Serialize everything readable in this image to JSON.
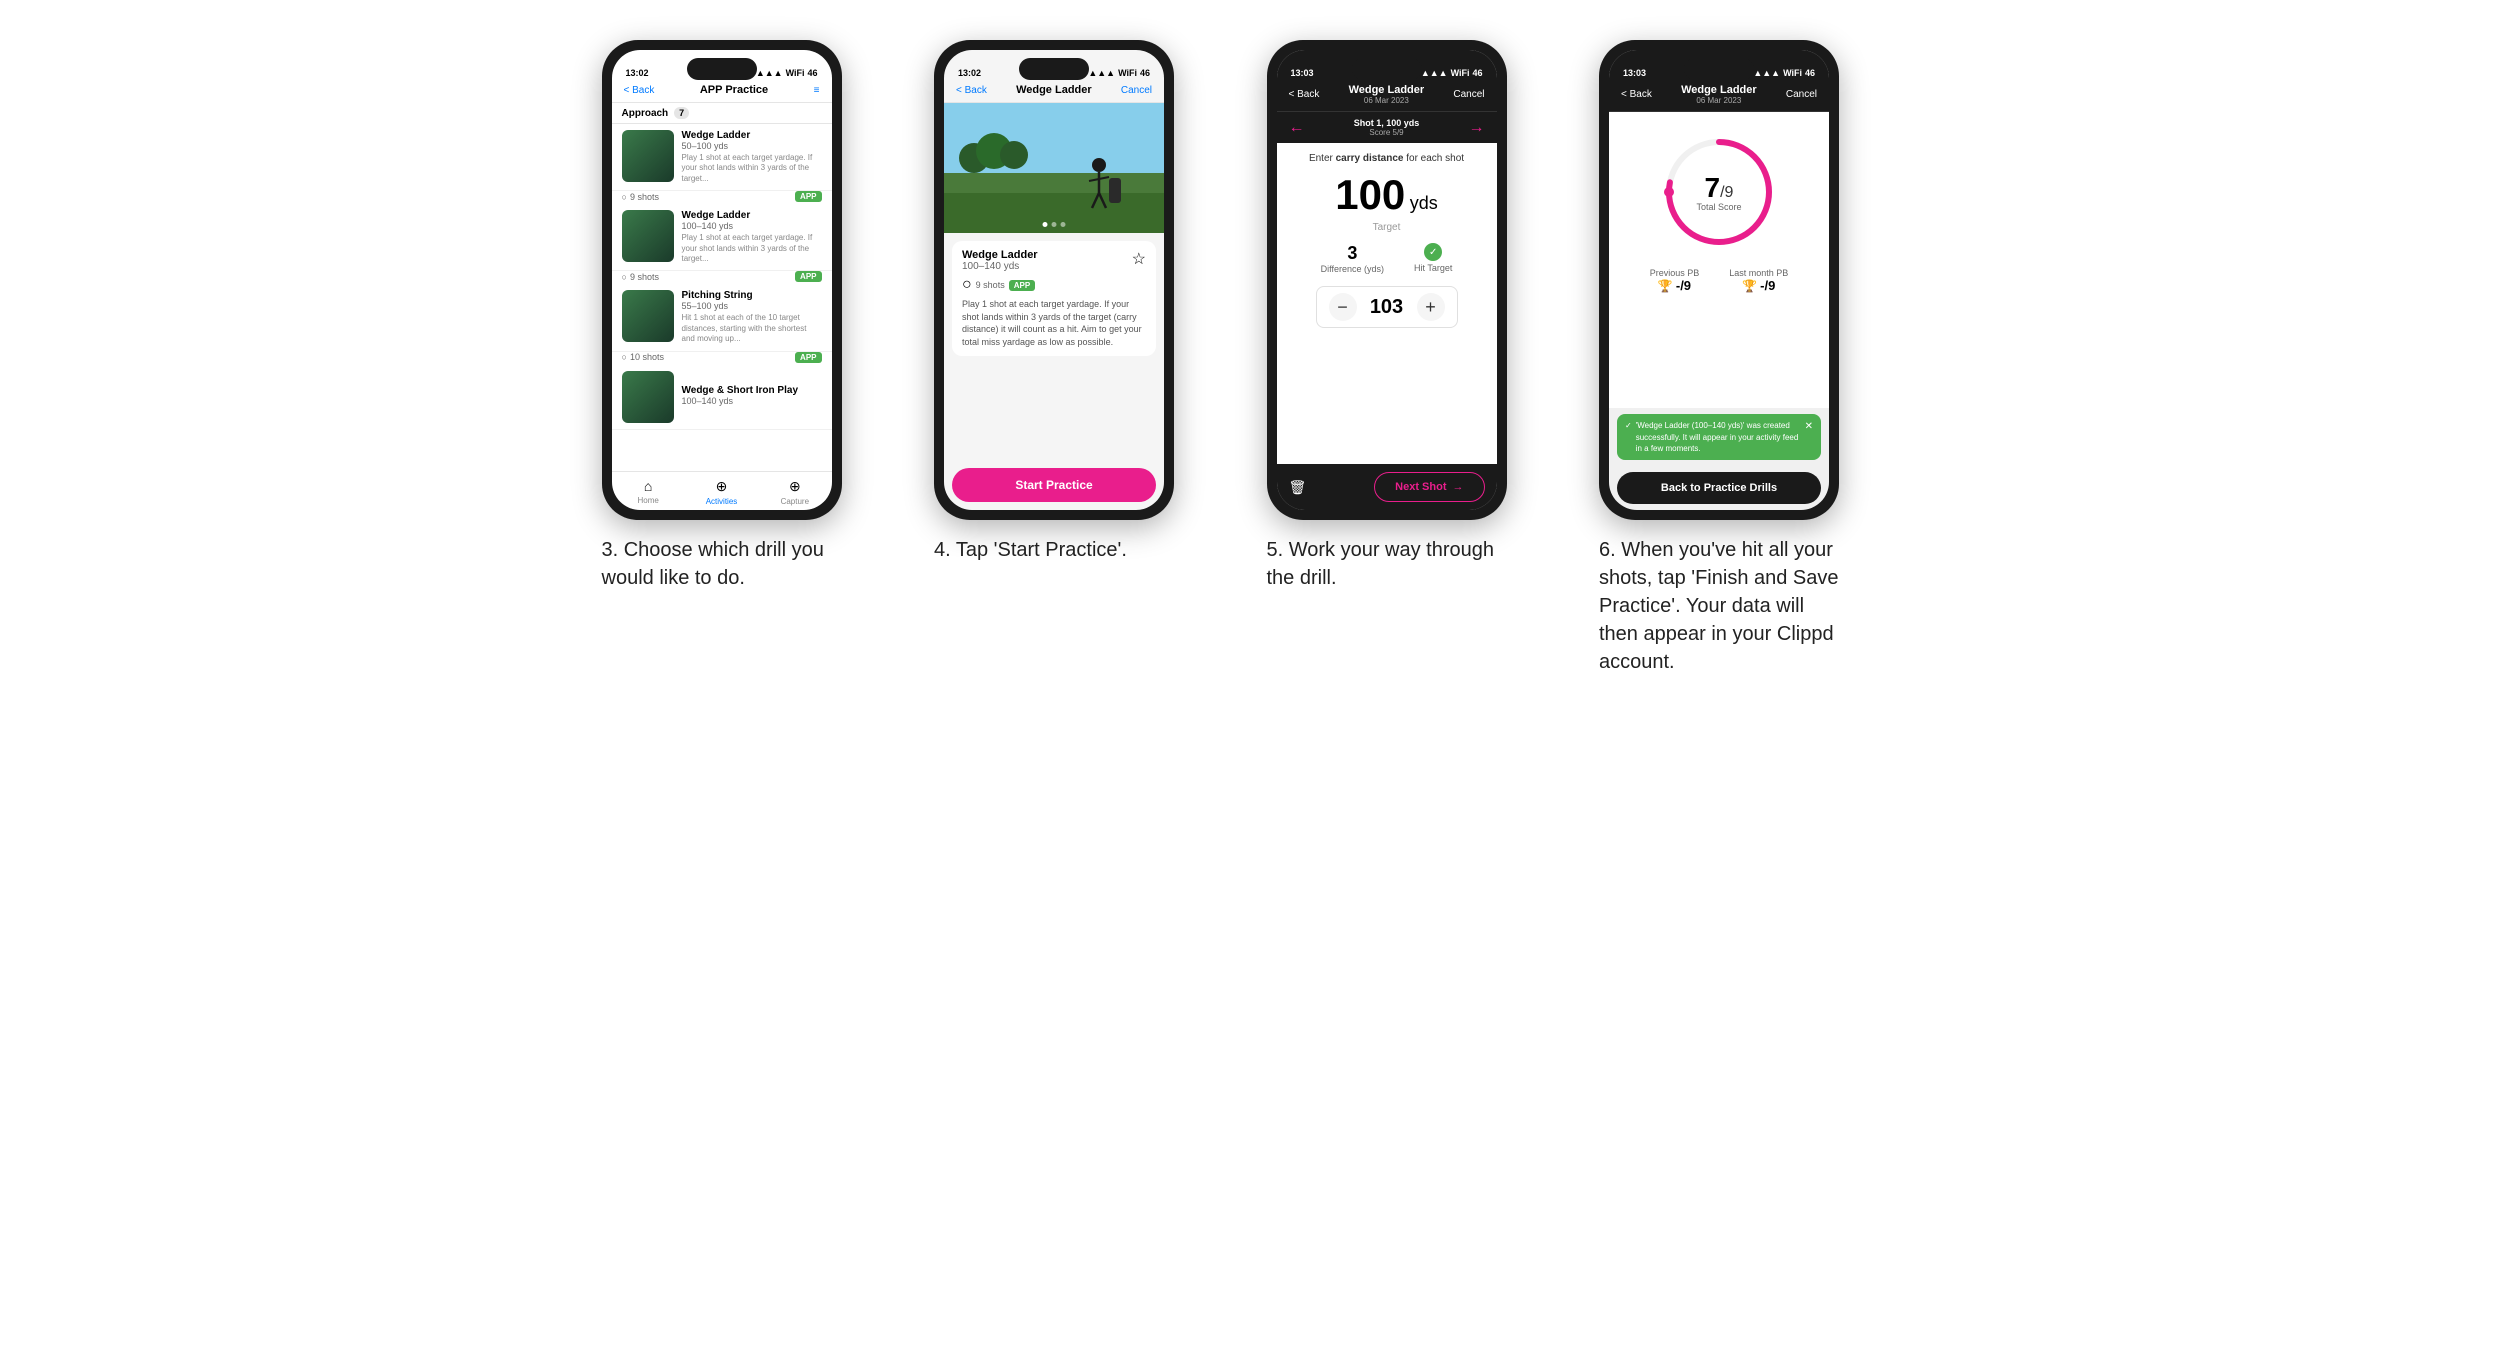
{
  "phones": [
    {
      "id": "phone1",
      "statusBar": {
        "time": "13:02",
        "signal": "▲▲▲",
        "wifi": "WiFi",
        "battery": "46"
      },
      "nav": {
        "back": "< Back",
        "title": "APP Practice",
        "action": "≡"
      },
      "section": {
        "label": "Approach",
        "count": "7"
      },
      "drills": [
        {
          "name": "Wedge Ladder",
          "yds": "50–100 yds",
          "desc": "Play 1 shot at each target yardage. If your shot lands within 3 yards of the target...",
          "shots": "9 shots",
          "badge": "APP"
        },
        {
          "name": "Wedge Ladder",
          "yds": "100–140 yds",
          "desc": "Play 1 shot at each target yardage. If your shot lands within 3 yards of the target...",
          "shots": "9 shots",
          "badge": "APP"
        },
        {
          "name": "Pitching String",
          "yds": "55–100 yds",
          "desc": "Hit 1 shot at each of the 10 target distances, starting with the shortest and moving up...",
          "shots": "10 shots",
          "badge": "APP"
        },
        {
          "name": "Wedge & Short Iron Play",
          "yds": "100–140 yds",
          "desc": "",
          "shots": "",
          "badge": ""
        }
      ],
      "tabs": [
        {
          "icon": "⌂",
          "label": "Home",
          "active": false
        },
        {
          "icon": "♦",
          "label": "Activities",
          "active": true
        },
        {
          "icon": "+",
          "label": "Capture",
          "active": false
        }
      ]
    },
    {
      "id": "phone2",
      "statusBar": {
        "time": "13:02",
        "signal": "▲▲▲",
        "wifi": "WiFi",
        "battery": "46"
      },
      "nav": {
        "back": "< Back",
        "title": "Wedge Ladder",
        "action": "Cancel"
      },
      "drill": {
        "name": "Wedge Ladder",
        "yds": "100–140 yds",
        "shots": "9 shots",
        "badge": "APP",
        "desc": "Play 1 shot at each target yardage. If your shot lands within 3 yards of the target (carry distance) it will count as a hit. Aim to get your total miss yardage as low as possible."
      },
      "startBtn": "Start Practice"
    },
    {
      "id": "phone3",
      "statusBar": {
        "time": "13:03",
        "signal": "▲▲▲",
        "wifi": "WiFi",
        "battery": "46"
      },
      "nav": {
        "back": "< Back",
        "title": "Wedge Ladder",
        "subtitle": "06 Mar 2023",
        "action": "Cancel"
      },
      "shotNav": {
        "shotNum": "Shot 1, 100 yds",
        "score": "Score 5/9"
      },
      "carryInstruction": "Enter carry distance for each shot",
      "targetDistance": "100",
      "targetUnit": "yds",
      "targetLabel": "Target",
      "stats": {
        "difference": "3",
        "differenceLabel": "Difference (yds)",
        "hitTarget": "Hit Target"
      },
      "inputValue": "103",
      "nextShotBtn": "Next Shot"
    },
    {
      "id": "phone4",
      "statusBar": {
        "time": "13:03",
        "signal": "▲▲▲",
        "wifi": "WiFi",
        "battery": "46"
      },
      "nav": {
        "back": "< Back",
        "title": "Wedge Ladder",
        "subtitle": "06 Mar 2023",
        "action": "Cancel"
      },
      "score": {
        "num": "7",
        "denom": "/9",
        "label": "Total Score"
      },
      "pbItems": [
        {
          "label": "Previous PB",
          "value": "-/9"
        },
        {
          "label": "Last month PB",
          "value": "-/9"
        }
      ],
      "toast": "'Wedge Ladder (100–140 yds)' was created successfully. It will appear in your activity feed in a few moments.",
      "backBtn": "Back to Practice Drills",
      "ringPercent": 78
    }
  ],
  "captions": [
    "3. Choose which drill you would like to do.",
    "4. Tap 'Start Practice'.",
    "5. Work your way through the drill.",
    "6. When you've hit all your shots, tap 'Finish and Save Practice'. Your data will then appear in your Clippd account."
  ]
}
